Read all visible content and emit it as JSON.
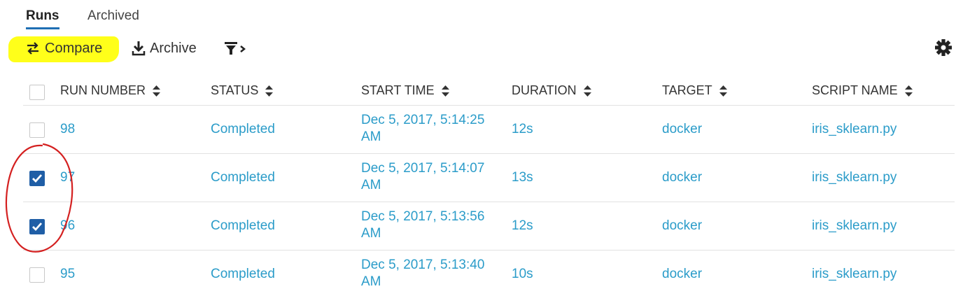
{
  "tabs": [
    {
      "label": "Runs",
      "active": true
    },
    {
      "label": "Archived",
      "active": false
    }
  ],
  "toolbar": {
    "compare_label": "Compare",
    "archive_label": "Archive",
    "compare_icon": "swap-arrows-icon",
    "archive_icon": "download-icon",
    "filter_icon": "filter-icon",
    "settings_icon": "gear-icon",
    "highlight_color": "#ffff1a"
  },
  "table": {
    "columns": [
      "RUN NUMBER",
      "STATUS",
      "START TIME",
      "DURATION",
      "TARGET",
      "SCRIPT NAME"
    ],
    "rows": [
      {
        "run": "98",
        "status": "Completed",
        "start_time": "Dec 5, 2017, 5:14:25 AM",
        "duration": "12s",
        "target": "docker",
        "script": "iris_sklearn.py",
        "checked": false
      },
      {
        "run": "97",
        "status": "Completed",
        "start_time": "Dec 5, 2017, 5:14:07 AM",
        "duration": "13s",
        "target": "docker",
        "script": "iris_sklearn.py",
        "checked": true
      },
      {
        "run": "96",
        "status": "Completed",
        "start_time": "Dec 5, 2017, 5:13:56 AM",
        "duration": "12s",
        "target": "docker",
        "script": "iris_sklearn.py",
        "checked": true
      },
      {
        "run": "95",
        "status": "Completed",
        "start_time": "Dec 5, 2017, 5:13:40 AM",
        "duration": "10s",
        "target": "docker",
        "script": "iris_sklearn.py",
        "checked": false
      }
    ]
  },
  "colors": {
    "link": "#2b9cc9",
    "checkbox_checked": "#1f5ea6",
    "tab_underline": "#1f6fb4",
    "annotation_circle": "#d42020"
  }
}
